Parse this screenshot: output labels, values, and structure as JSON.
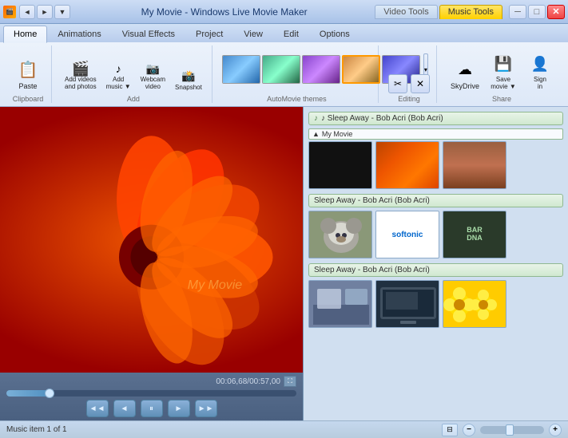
{
  "titleBar": {
    "icon": "🎬",
    "appName": "My Movie - Windows Live Movie Maker",
    "tabs": [
      {
        "label": "Video Tools",
        "active": false
      },
      {
        "label": "Music Tools",
        "active": true
      }
    ],
    "controls": {
      "minimize": "─",
      "maximize": "□",
      "close": "✕"
    }
  },
  "navButtons": {
    "back": "◄",
    "forward": "►",
    "dropdown": "▼"
  },
  "ribbon": {
    "tabs": [
      {
        "label": "Home",
        "active": true
      },
      {
        "label": "Animations",
        "active": false
      },
      {
        "label": "Visual Effects",
        "active": false
      },
      {
        "label": "Project",
        "active": false
      },
      {
        "label": "View",
        "active": false
      },
      {
        "label": "Edit",
        "active": false
      },
      {
        "label": "Options",
        "active": false
      }
    ],
    "groups": {
      "clipboard": {
        "label": "Clipboard",
        "paste": "Paste"
      },
      "add": {
        "label": "Add",
        "addVideos": {
          "icon": "🎬",
          "label": "Add videos\nand photos"
        },
        "addMusic": {
          "icon": "♪",
          "label": "Add\nmusic"
        },
        "webcamVideo": {
          "icon": "📷",
          "label": "Webcam\nvideo"
        },
        "snapshot": {
          "icon": "📸",
          "label": "Snapshot"
        }
      },
      "autoMovieThemes": {
        "label": "AutoMovie themes",
        "themes": [
          {
            "id": "theme1",
            "style": "theme-1"
          },
          {
            "id": "theme2",
            "style": "theme-2"
          },
          {
            "id": "theme3",
            "style": "theme-3"
          },
          {
            "id": "theme4",
            "style": "theme-4",
            "selected": true
          },
          {
            "id": "theme5",
            "style": "theme-5"
          }
        ]
      },
      "editing": {
        "label": "Editing",
        "cutIcon": "✂",
        "deleteIcon": "✕"
      },
      "share": {
        "label": "Share",
        "skyDrive": {
          "icon": "☁",
          "label": "SkyDrive"
        },
        "saveMovie": {
          "icon": "💾",
          "label": "Save\nmovie"
        },
        "signIn": {
          "icon": "👤",
          "label": "Sign\nin"
        }
      }
    }
  },
  "preview": {
    "watermark": "My Movie",
    "timeDisplay": "00:06,68/00:57,00",
    "controls": {
      "rewind": "◄◄",
      "back": "◄",
      "pause": "⏸",
      "forward": "►",
      "fastForward": "►►"
    }
  },
  "storyboard": {
    "sections": [
      {
        "id": "section1",
        "header": "♪ Sleep Away - Bob Acri (Bob Acri)",
        "thumbLabel": "▲ My Movie",
        "thumbs": [
          {
            "style": "thumb-black",
            "label": ""
          },
          {
            "style": "thumb-orange",
            "label": ""
          },
          {
            "style": "thumb-redrock",
            "label": ""
          }
        ]
      },
      {
        "id": "section2",
        "header": "Sleep Away - Bob Acri (Bob Acri)",
        "thumbs": [
          {
            "style": "thumb-koala",
            "label": ""
          },
          {
            "style": "thumb-logo",
            "label": "",
            "type": "softonic"
          },
          {
            "style": "thumb-sign",
            "label": "",
            "type": "dna"
          }
        ]
      },
      {
        "id": "section3",
        "header": "Sleep Away - Bob Acri (Bob Acri)",
        "thumbs": [
          {
            "style": "thumb-room",
            "label": ""
          },
          {
            "style": "thumb-screen",
            "label": ""
          },
          {
            "style": "thumb-flowers",
            "label": ""
          }
        ]
      }
    ]
  },
  "statusBar": {
    "text": "Music item 1 of 1",
    "zoomMinus": "−",
    "zoomPlus": "+"
  }
}
